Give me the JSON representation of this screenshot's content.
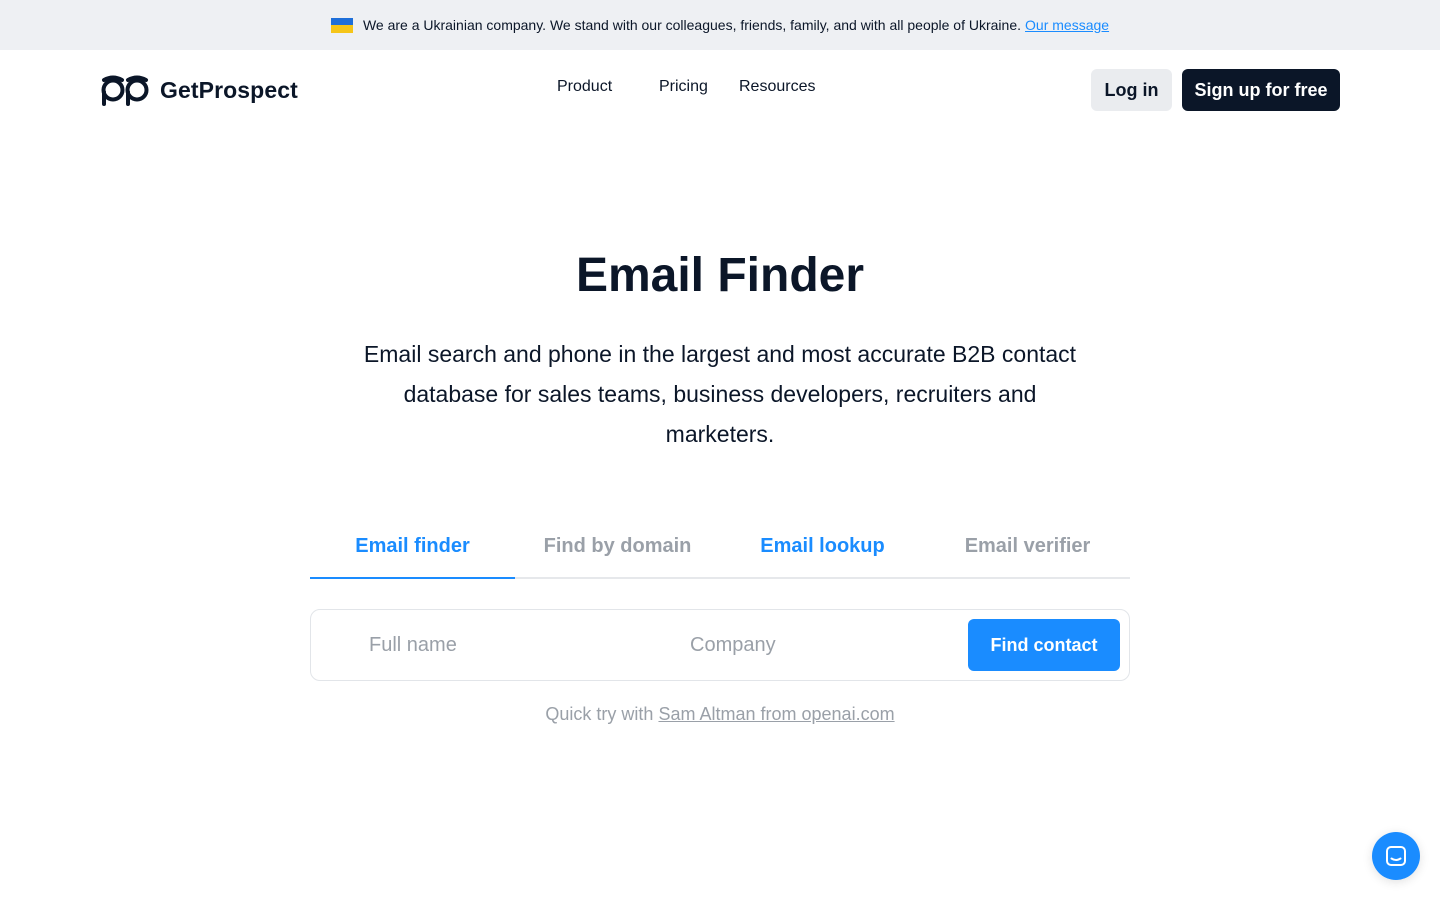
{
  "banner": {
    "text": "We are a Ukrainian company. We stand with our colleagues, friends, family, and with all people of Ukraine.",
    "link": "Our message",
    "flag_colors": [
      "#1e6fd9",
      "#f5c518"
    ]
  },
  "header": {
    "brand": "GetProspect",
    "nav": [
      "Product",
      "Pricing",
      "Resources"
    ],
    "login": "Log in",
    "signup": "Sign up for free"
  },
  "hero": {
    "title": "Email Finder",
    "subtitle": "Email search and phone in the largest and most accurate B2B contact database for sales teams, business developers, recruiters and marketers."
  },
  "tabs": [
    {
      "label": "Email finder",
      "active": true
    },
    {
      "label": "Find by domain",
      "active": false
    },
    {
      "label": "Email lookup",
      "active": false
    },
    {
      "label": "Email verifier",
      "active": false
    }
  ],
  "search": {
    "name_placeholder": "Full name",
    "company_placeholder": "Company",
    "name_value": "",
    "company_value": "",
    "button": "Find contact"
  },
  "quick_try": {
    "prefix": "Quick try with",
    "link": "Sam Altman from openai.com"
  },
  "colors": {
    "accent": "#1a8cff",
    "dark": "#0b1628",
    "muted": "#9aa0a8"
  },
  "icons": {
    "logo": "owl-eyes-logo-icon",
    "chat": "chat-bubble-icon"
  }
}
